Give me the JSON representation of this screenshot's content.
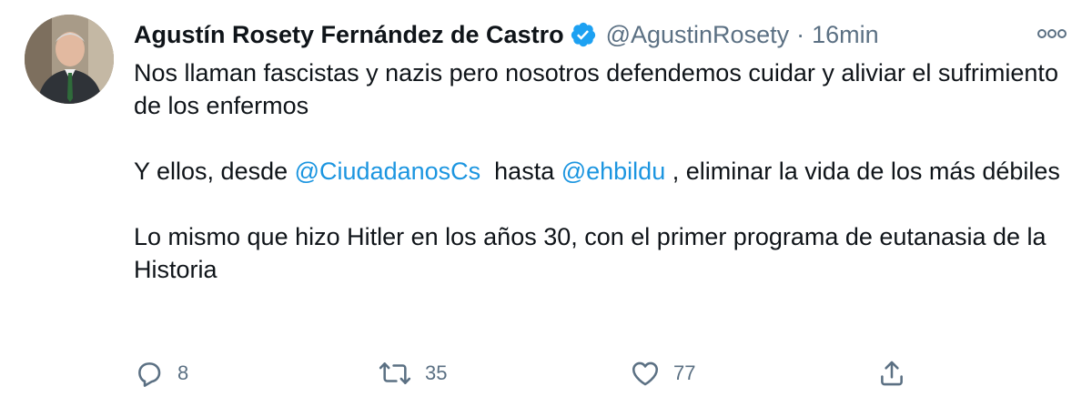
{
  "author": {
    "display_name": "Agustín Rosety Fernández de Castro",
    "handle": "@AgustinRosety",
    "separator": "·",
    "time": "16min",
    "avatar_icon": "profile-photo",
    "verified_icon": "verified-badge-icon"
  },
  "tweet": {
    "line1": "Nos llaman fascistas y nazis pero nosotros defendemos cuidar y aliviar el sufrimiento de los enfermos",
    "line2_prefix": "Y ellos, desde ",
    "mention1": "@CiudadanosCs",
    "line2_middle": "  hasta ",
    "mention2": "@ehbildu",
    "line2_suffix": " , eliminar la vida de los más débiles",
    "line3": "Lo mismo que hizo Hitler en los años 30, con el primer programa de eutanasia de la Historia"
  },
  "actions": {
    "reply_count": "8",
    "retweet_count": "35",
    "like_count": "77",
    "reply_icon": "reply-icon",
    "retweet_icon": "retweet-icon",
    "like_icon": "heart-icon",
    "share_icon": "share-icon"
  },
  "colors": {
    "text": "#0f1419",
    "secondary": "#5b7083",
    "link": "#1b95e0",
    "verified": "#1da1f2"
  }
}
